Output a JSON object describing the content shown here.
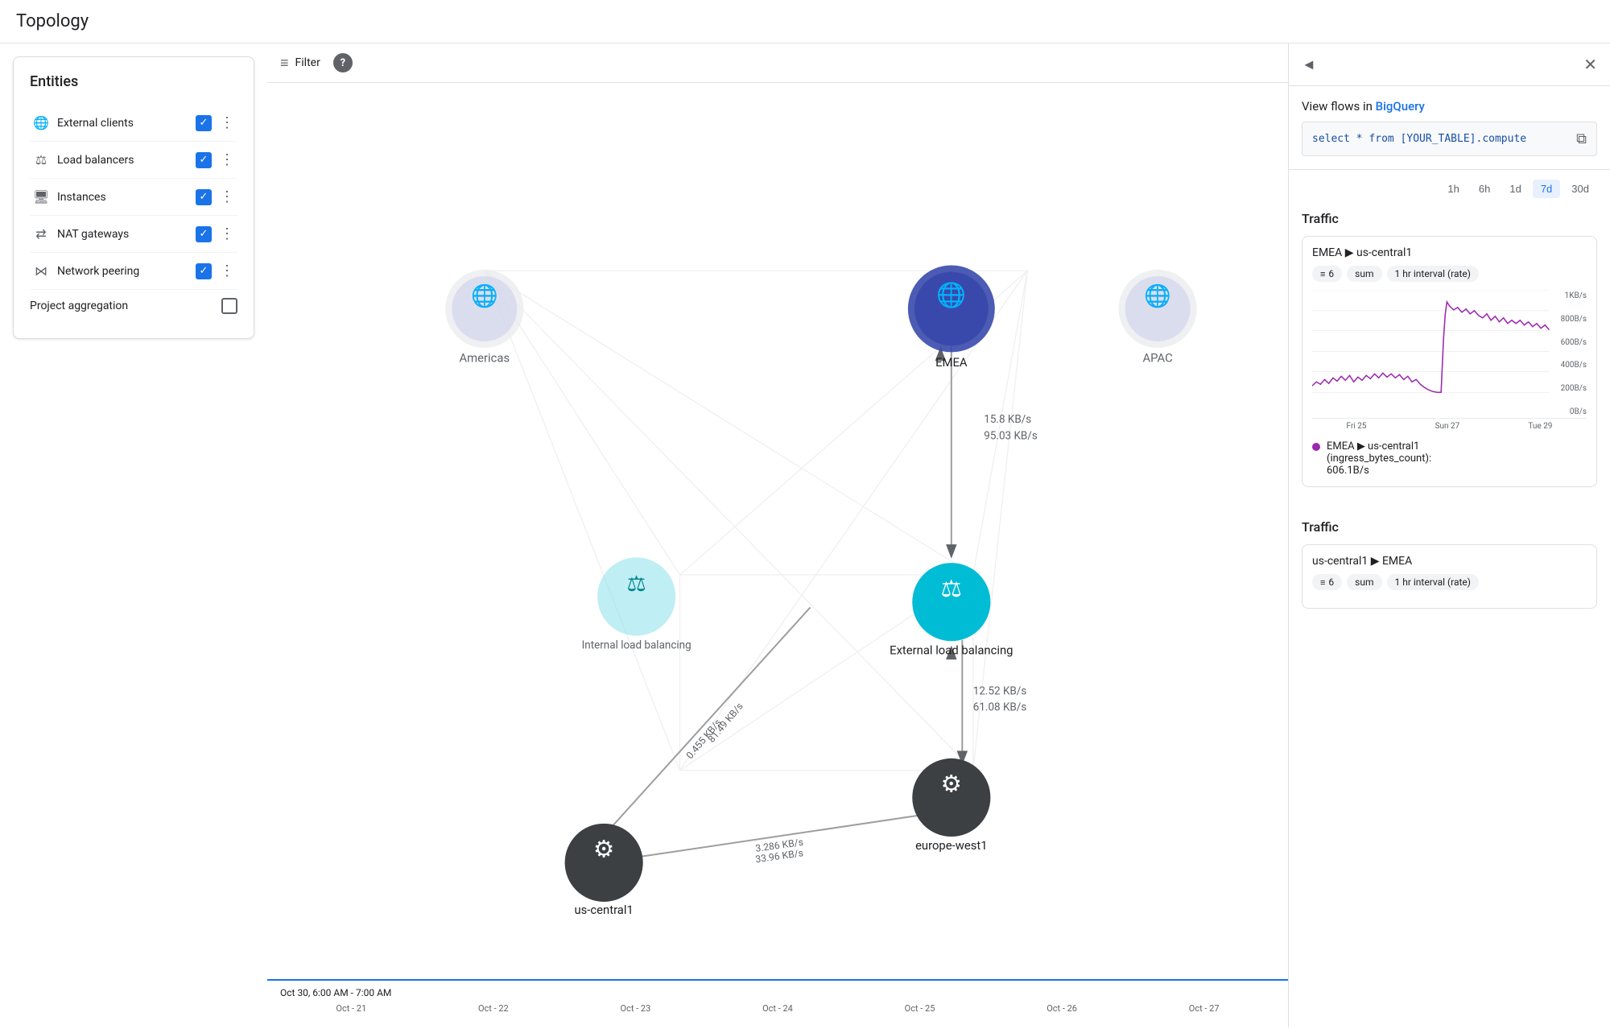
{
  "page": {
    "title": "Topology"
  },
  "entities": {
    "title": "Entities",
    "items": [
      {
        "id": "external-clients",
        "label": "External clients",
        "icon": "🌐",
        "checked": true
      },
      {
        "id": "load-balancers",
        "label": "Load balancers",
        "icon": "⚖",
        "checked": true
      },
      {
        "id": "instances",
        "label": "Instances",
        "icon": "🖥",
        "checked": true
      },
      {
        "id": "nat-gateways",
        "label": "NAT gateways",
        "icon": "⇄",
        "checked": true
      },
      {
        "id": "network-peering",
        "label": "Network peering",
        "icon": "⋈",
        "checked": true
      }
    ],
    "project_aggregation": {
      "label": "Project aggregation",
      "checked": false
    }
  },
  "filter": {
    "label": "Filter"
  },
  "timeline": {
    "range_label": "Oct 30, 6:00 AM - 7:00 AM",
    "ticks": [
      "Oct - 21",
      "Oct - 22",
      "Oct - 23",
      "Oct - 24",
      "Oct - 25",
      "Oct - 26",
      "Oct - 27"
    ]
  },
  "right_panel": {
    "collapse_icon": "◄",
    "close_icon": "✕",
    "bigquery": {
      "title": "View flows in ",
      "link_text": "BigQuery",
      "query": "select * from [YOUR_TABLE].compute"
    },
    "time_buttons": [
      {
        "label": "1h",
        "active": false
      },
      {
        "label": "6h",
        "active": false
      },
      {
        "label": "1d",
        "active": false
      },
      {
        "label": "7d",
        "active": true
      },
      {
        "label": "30d",
        "active": false
      }
    ],
    "traffic_sections": [
      {
        "title": "Traffic",
        "card": {
          "direction": "EMEA ▶ us-central1",
          "badges": [
            "≡ 6",
            "sum",
            "1 hr interval (rate)"
          ],
          "y_labels": [
            "1KB/s",
            "800B/s",
            "600B/s",
            "400B/s",
            "200B/s",
            "0B/s"
          ],
          "x_labels": [
            "Fri 25",
            "Sun 27",
            "Tue 29"
          ],
          "legend": {
            "label": "EMEA ▶ us-central1",
            "sub": "(ingress_bytes_count):",
            "value": "606.1B/s"
          }
        }
      },
      {
        "title": "Traffic",
        "card": {
          "direction": "us-central1 ▶ EMEA",
          "badges": [
            "≡ 6",
            "sum",
            "1 hr interval (rate)"
          ]
        }
      }
    ],
    "nodes": {
      "emea": "EMEA",
      "apac": "APAC",
      "americas": "Americas",
      "external_lb": "External load balancing",
      "europe_west1": "europe-west1",
      "us_central1": "us-central1"
    },
    "flows": {
      "emea_to_lb_down": "15.8 KB/s",
      "emea_to_lb_up": "95.03 KB/s",
      "lb_to_europe_down": "12.52 KB/s",
      "lb_to_europe_up": "61.08 KB/s",
      "diag_down": "0.455 KB/s",
      "diag_up": "81.49 KB/s",
      "diag2_down": "3.286 KB/s",
      "diag2_up": "33.96 KB/s"
    }
  }
}
